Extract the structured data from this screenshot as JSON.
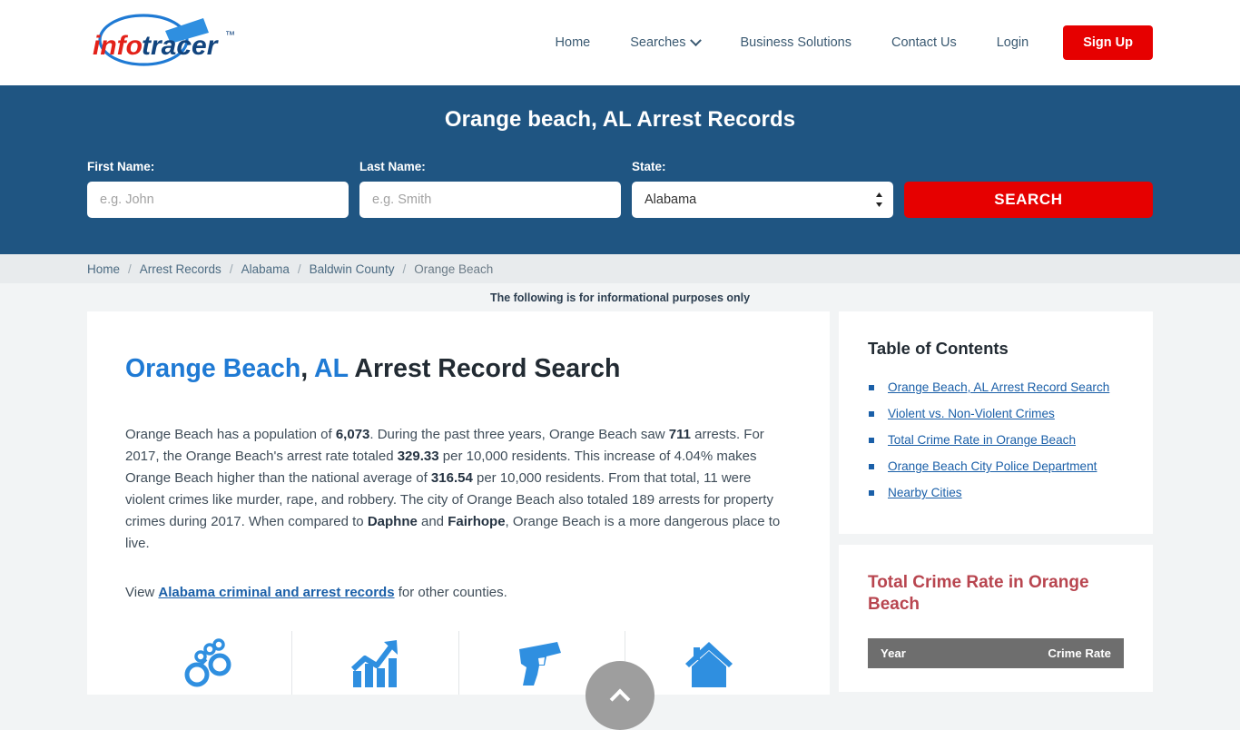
{
  "header": {
    "logo": {
      "name": "infotracer-logo",
      "text_info": "info",
      "text_tracer": "tracer",
      "trademark": "™"
    },
    "nav": [
      {
        "label": "Home",
        "icon": null
      },
      {
        "label": "Searches",
        "icon": "chevron-down-icon"
      },
      {
        "label": "Business Solutions",
        "icon": null
      },
      {
        "label": "Contact Us",
        "icon": null
      },
      {
        "label": "Login",
        "icon": null
      }
    ],
    "signup_label": "Sign Up"
  },
  "search_band": {
    "title": "Orange beach, AL Arrest Records",
    "first_name_label": "First Name:",
    "first_name_placeholder": "e.g. John",
    "first_name_value": "",
    "last_name_label": "Last Name:",
    "last_name_placeholder": "e.g. Smith",
    "last_name_value": "",
    "state_label": "State:",
    "state_selected": "Alabama",
    "state_options": [
      "Alabama"
    ],
    "search_button": "SEARCH",
    "colors": {
      "band_bg": "#1f5582",
      "button_bg": "#e60000"
    }
  },
  "breadcrumb": {
    "items": [
      "Home",
      "Arrest Records",
      "Alabama",
      "Baldwin County",
      "Orange Beach"
    ],
    "separator": "/"
  },
  "disclaimer": "The following is for informational purposes only",
  "main": {
    "title_city": "Orange Beach",
    "title_comma": ", ",
    "title_state": "AL",
    "title_rest": " Arrest Record Search",
    "paragraph": {
      "p1": "Orange Beach has a population of ",
      "population": "6,073",
      "p2": ". During the past three years, Orange Beach saw ",
      "arrests": "711",
      "p3": " arrests. For 2017, the Orange Beach's arrest rate totaled ",
      "arrest_rate": "329.33",
      "p4": " per 10,000 residents. This increase of 4.04% makes Orange Beach higher than the national average of ",
      "national_average": "316.54",
      "p5": " per 10,000 residents. From that total, 11 were violent crimes like murder, rape, and robbery. The city of Orange Beach also totaled 189 arrests for property crimes during 2017. When compared to ",
      "city_a": "Daphne",
      "p6": " and ",
      "city_b": "Fairhope",
      "p7": ", Orange Beach is a more dangerous place to live."
    },
    "view_prefix": "View ",
    "view_link": "Alabama criminal and arrest records",
    "view_suffix": " for other counties.",
    "icons": [
      "handcuffs-icon",
      "growth-chart-icon",
      "gun-icon",
      "house-icon"
    ]
  },
  "sidebar": {
    "toc_title": "Table of Contents",
    "toc_items": [
      "Orange Beach, AL Arrest Record Search",
      "Violent vs. Non-Violent Crimes",
      "Total Crime Rate in Orange Beach",
      "Orange Beach City Police Department",
      "Nearby Cities"
    ],
    "crime_card": {
      "title": "Total Crime Rate in Orange Beach",
      "table_headers": [
        "Year",
        "Crime Rate"
      ],
      "header_bg": "#6e6e6e",
      "title_color": "#b8454f"
    }
  },
  "scroll_top": {
    "name": "scroll-to-top-button",
    "icon": "chevron-up-icon"
  }
}
